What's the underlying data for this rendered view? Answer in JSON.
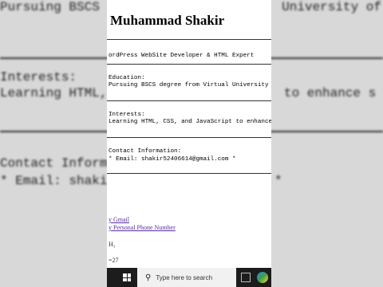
{
  "background": {
    "top_left": "Pursuing BSCS",
    "top_right": "University of",
    "interests_label": "Interests:",
    "interests_text": "Learning HTML,",
    "interests_tail": "to enhance s",
    "contact_label": "Contact Inform",
    "email_prefix": "* Email: shaki",
    "email_tail": "*"
  },
  "page": {
    "title": "Muhammad Shakir",
    "role": "ordPress WebSite Developer & HTML Expert",
    "education_label": "Education:",
    "education_text": "Pursuing BSCS degree from Virtual University of",
    "interests_label": "Interests:",
    "interests_text": "Learning HTML, CSS, and JavaScript to enhance s",
    "contact_label": "Contact Information:",
    "email_line": "* Email: shakir52406614@gmail.com *",
    "links": [
      "y Gmail",
      "y Personal Phone Number"
    ],
    "small_line_1": "H₃",
    "small_line_2": "=27"
  },
  "taskbar": {
    "search_placeholder": "Type here to search"
  }
}
